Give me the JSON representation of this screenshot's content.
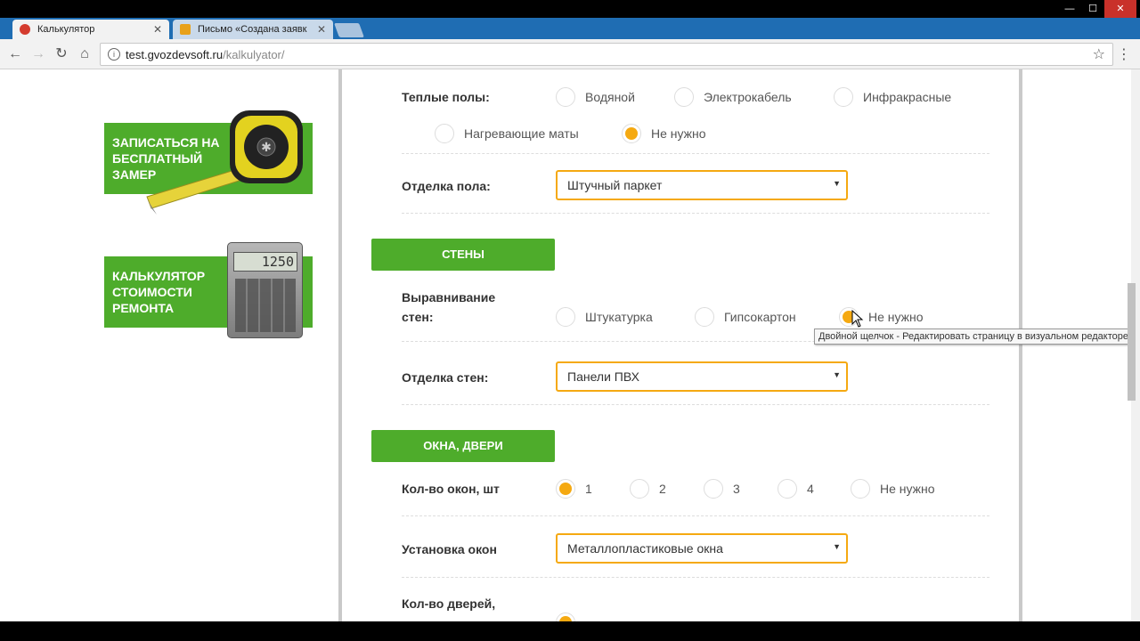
{
  "browser": {
    "tabs": [
      {
        "label": "Калькулятор",
        "active": true,
        "favicon_color": "#d43b2e"
      },
      {
        "label": "Письмо «Создана заявк",
        "active": false,
        "favicon_color": "#e8a11a"
      }
    ],
    "url_domain": "test.gvozdevsoft.ru",
    "url_path": "/kalkulyator/"
  },
  "promos": [
    {
      "text": "Записаться на бесплатный замер"
    },
    {
      "text": "Калькулятор стоимости ремонта"
    }
  ],
  "calc_display": "1250",
  "floor": {
    "heating_label": "Теплые полы:",
    "heating_options": [
      {
        "label": "Водяной",
        "selected": false
      },
      {
        "label": "Электрокабель",
        "selected": false
      },
      {
        "label": "Инфракрасные",
        "selected": false
      },
      {
        "label": "Нагревающие маты",
        "selected": false
      },
      {
        "label": "Не нужно",
        "selected": true
      }
    ],
    "finish_label": "Отделка пола:",
    "finish_value": "Штучный паркет"
  },
  "walls": {
    "section_title": "Стены",
    "leveling_label_1": "Выравнивание",
    "leveling_label_2": "стен:",
    "leveling_options": [
      {
        "label": "Штукатурка",
        "selected": false
      },
      {
        "label": "Гипсокартон",
        "selected": false
      },
      {
        "label": "Не нужно",
        "selected": true
      }
    ],
    "finish_label": "Отделка стен:",
    "finish_value": "Панели ПВХ"
  },
  "windows": {
    "section_title": "Окна, двери",
    "count_label": "Кол-во окон, шт",
    "count_options": [
      {
        "label": "1",
        "selected": true
      },
      {
        "label": "2",
        "selected": false
      },
      {
        "label": "3",
        "selected": false
      },
      {
        "label": "4",
        "selected": false
      },
      {
        "label": "Не нужно",
        "selected": false
      }
    ],
    "install_label": "Установка окон",
    "install_value": "Металлопластиковые окна",
    "doors_label": "Кол-во дверей,"
  },
  "tooltip": "Двойной щелчок - Редактировать страницу в визуальном редакторе",
  "colors": {
    "accent_green": "#4eac2b",
    "accent_orange": "#f5a911"
  }
}
